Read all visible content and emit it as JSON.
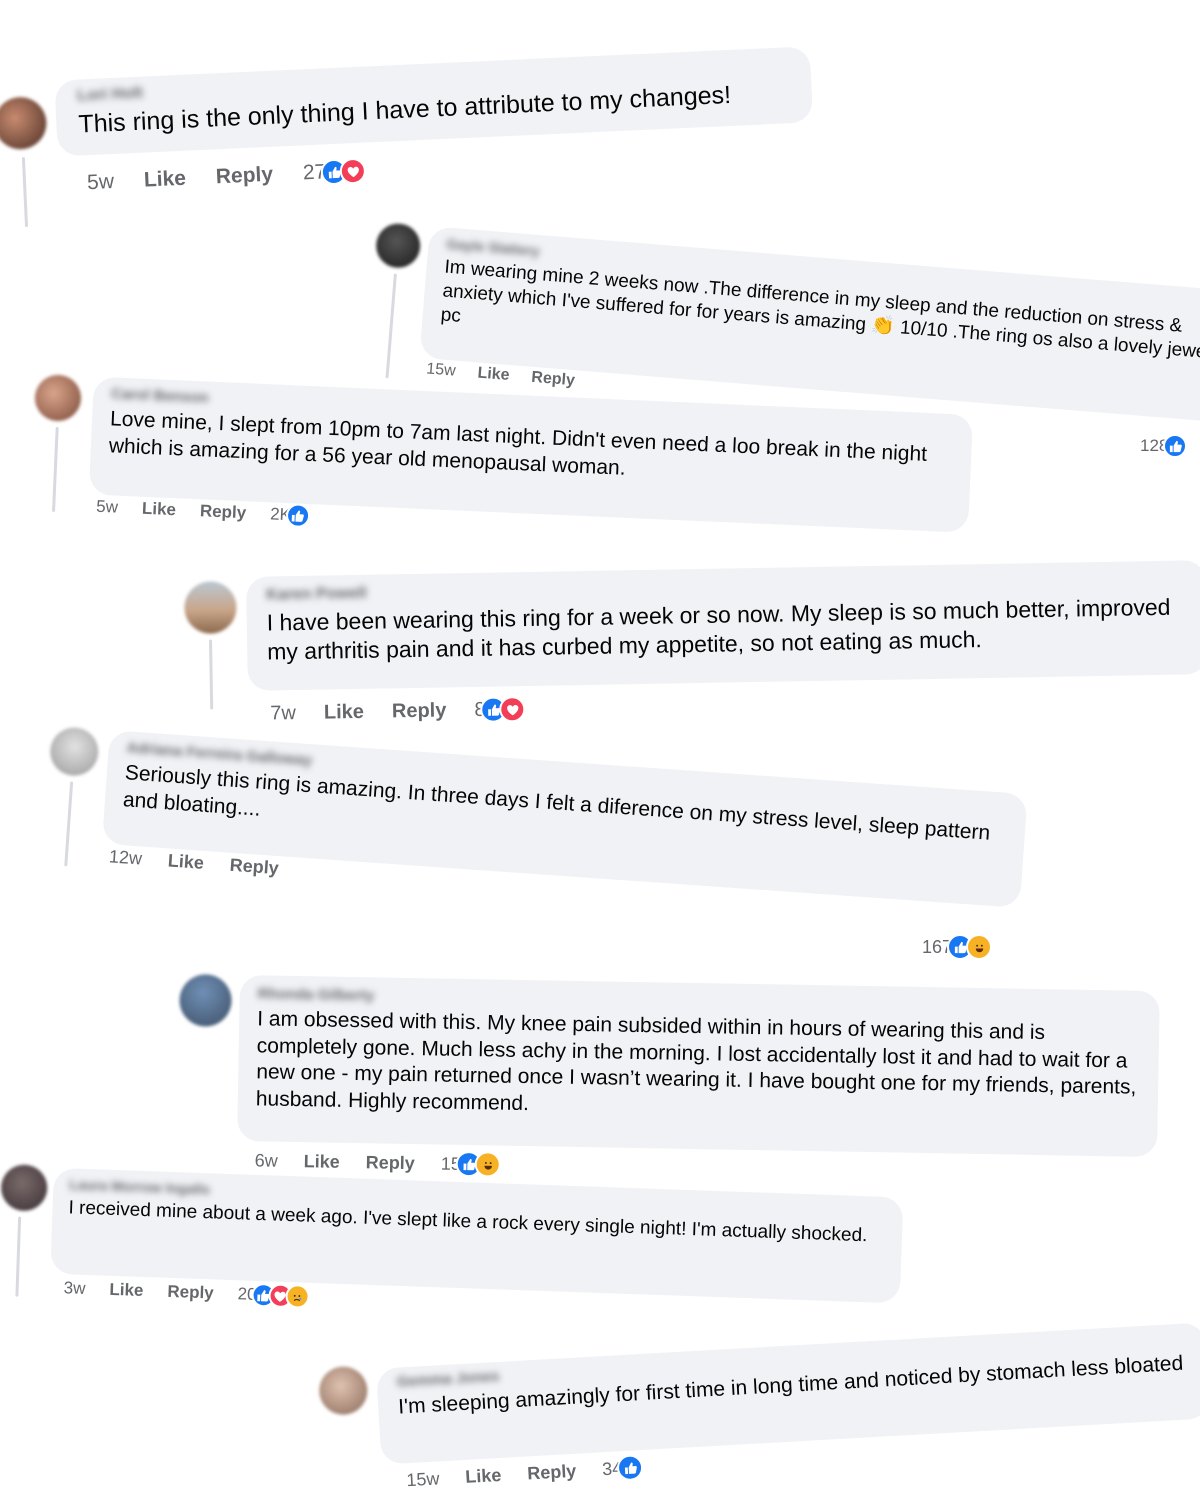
{
  "comments": [
    {
      "name": "Lori Holt",
      "text": "This ring is the only thing I have to attribute to my changes!",
      "time": "5w",
      "like": "Like",
      "reply": "Reply",
      "count": "27",
      "reactions": [
        "like",
        "love"
      ]
    },
    {
      "name": "Gayle Slattery",
      "text": "Im wearing mine 2 weeks now .The difference in my sleep and the reduction on stress & anxiety which I've suffered for for years is amazing 👏 10/10 .The ring os also a lovely jewelry pc",
      "time": "15w",
      "like": "Like",
      "reply": "Reply",
      "count": "128",
      "reactions": [
        "like"
      ]
    },
    {
      "name": "Carol Benson",
      "text": "Love mine, I slept from 10pm to 7am last night. Didn't even need a loo break in the night which is amazing for a 56 year old menopausal woman.",
      "time": "5w",
      "like": "Like",
      "reply": "Reply",
      "count": "2K",
      "reactions": [
        "like"
      ]
    },
    {
      "name": "Karen Powell",
      "text": "I have been wearing this ring for a week or so now. My sleep is so much better, improved my arthritis pain and it has curbed my appetite, so not eating as much.",
      "time": "7w",
      "like": "Like",
      "reply": "Reply",
      "count": "8",
      "reactions": [
        "like",
        "love"
      ]
    },
    {
      "name": "Adriana Ferreira Galloway",
      "text": "Seriously this ring is amazing. In three days I felt a diference on my stress level, sleep pattern and bloating....",
      "time": "12w",
      "like": "Like",
      "reply": "Reply",
      "count": "167",
      "reactions": [
        "like",
        "haha"
      ]
    },
    {
      "name": "Rhonda Gilberty",
      "text": "I am obsessed with this. My knee pain subsided within in hours of wearing this and is completely gone. Much less achy in the morning. I lost accidentally lost it and had to wait for a new one - my pain returned once I wasn’t wearing it. I have bought one for my friends, parents, husband. Highly recommend.",
      "time": "6w",
      "like": "Like",
      "reply": "Reply",
      "count": "15",
      "reactions": [
        "like",
        "haha"
      ]
    },
    {
      "name": "Laura Morrow Ingalls",
      "text": "I received mine about a week ago. I've slept like a rock every single night! I'm actually shocked.",
      "time": "3w",
      "like": "Like",
      "reply": "Reply",
      "count": "20",
      "reactions": [
        "like",
        "love",
        "sad"
      ]
    },
    {
      "name": "Gemma Jones",
      "text": "I'm sleeping amazingly for first time in long time and noticed by stomach less bloated",
      "time": "15w",
      "like": "Like",
      "reply": "Reply",
      "count": "34",
      "reactions": [
        "like"
      ]
    }
  ]
}
